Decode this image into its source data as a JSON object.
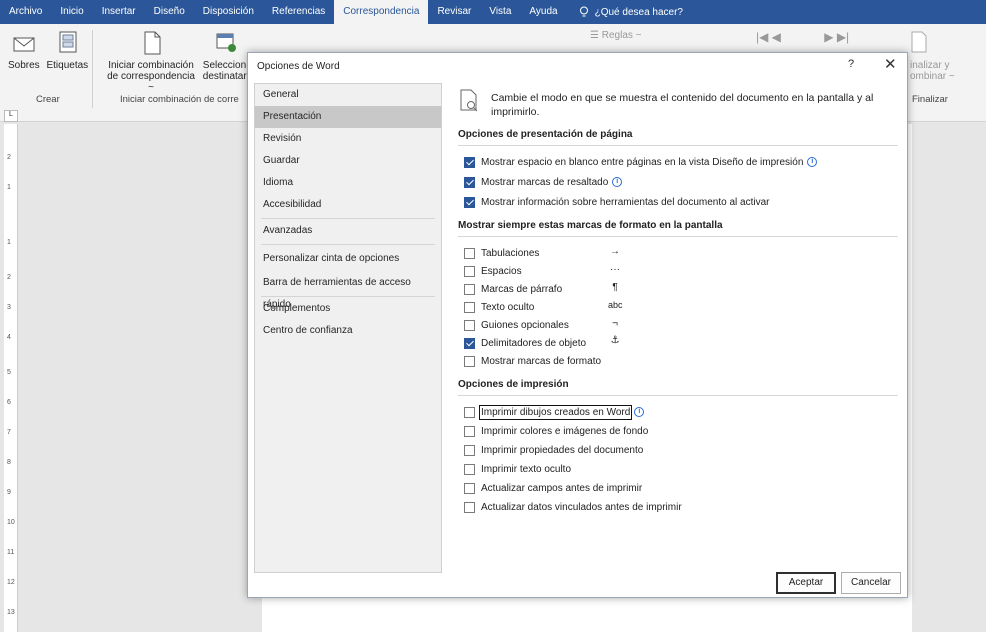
{
  "ribbon_tabs": [
    "Archivo",
    "Inicio",
    "Insertar",
    "Diseño",
    "Disposición",
    "Referencias",
    "Correspondencia",
    "Revisar",
    "Vista",
    "Ayuda"
  ],
  "tell_me": "¿Qué desea hacer?",
  "ribbon": {
    "sobres": "Sobres",
    "etiquetas": "Etiquetas",
    "grupo_crear": "Crear",
    "iniciar_combinacion_1": "Iniciar combinación",
    "iniciar_combinacion_2": "de correspondencia ~",
    "seleccionar_1": "Seleccion",
    "seleccionar_2": "destinatari",
    "grupo_iniciar": "Iniciar combinación de corre",
    "reglas": "Reglas ~",
    "finalizar_1": "inalizar y",
    "finalizar_2": "ombinar ~",
    "grupo_finalizar": "Finalizar"
  },
  "ruler_marks": [
    "2",
    "1",
    "1",
    "2",
    "3",
    "4",
    "5",
    "6",
    "7",
    "8",
    "9",
    "10",
    "11",
    "12",
    "13"
  ],
  "dialog": {
    "title": "Opciones de Word",
    "help": "?",
    "close": "✕",
    "nav": [
      {
        "label": "General"
      },
      {
        "label": "Presentación"
      },
      {
        "label": "Revisión"
      },
      {
        "label": "Guardar"
      },
      {
        "label": "Idioma"
      },
      {
        "label": "Accesibilidad"
      },
      {
        "label": "Avanzadas"
      },
      {
        "label": "Personalizar cinta de opciones"
      },
      {
        "label": "Barra de herramientas de acceso rápido"
      },
      {
        "label": "Complementos"
      },
      {
        "label": "Centro de confianza"
      }
    ],
    "intro": "Cambie el modo en que se muestra el contenido del documento en la pantalla y al imprimirlo.",
    "sections": {
      "page_display": "Opciones de presentación de página",
      "format_marks": "Mostrar siempre estas marcas de formato en la pantalla",
      "print": "Opciones de impresión"
    },
    "page_display_options": [
      {
        "label": "Mostrar espacio en blanco entre páginas en la vista Diseño de impresión",
        "checked": true,
        "info": true
      },
      {
        "label": "Mostrar marcas de resaltado",
        "checked": true,
        "info": true
      },
      {
        "label": "Mostrar información sobre herramientas del documento al activar",
        "checked": true,
        "info": false
      }
    ],
    "format_marks": [
      {
        "label": "Tabulaciones",
        "checked": false,
        "symbol": "→"
      },
      {
        "label": "Espacios",
        "checked": false,
        "symbol": "···"
      },
      {
        "label": "Marcas de párrafo",
        "checked": false,
        "symbol": "¶"
      },
      {
        "label": "Texto oculto",
        "checked": false,
        "symbol": "abc"
      },
      {
        "label": "Guiones opcionales",
        "checked": false,
        "symbol": "¬"
      },
      {
        "label": "Delimitadores de objeto",
        "checked": true,
        "symbol": "⚓"
      },
      {
        "label": "Mostrar marcas de formato",
        "checked": false,
        "symbol": ""
      }
    ],
    "print_options": [
      {
        "label": "Imprimir dibujos creados en Word",
        "checked": false,
        "info": true
      },
      {
        "label": "Imprimir colores e imágenes de fondo",
        "checked": false,
        "info": false
      },
      {
        "label": "Imprimir propiedades del documento",
        "checked": false,
        "info": false
      },
      {
        "label": "Imprimir texto oculto",
        "checked": false,
        "info": false
      },
      {
        "label": "Actualizar campos antes de imprimir",
        "checked": false,
        "info": false
      },
      {
        "label": "Actualizar datos vinculados antes de imprimir",
        "checked": false,
        "info": false
      }
    ],
    "ok": "Aceptar",
    "cancel": "Cancelar"
  },
  "colors": {
    "accent": "#2b579a",
    "selected_nav": "#c8c8c8"
  }
}
